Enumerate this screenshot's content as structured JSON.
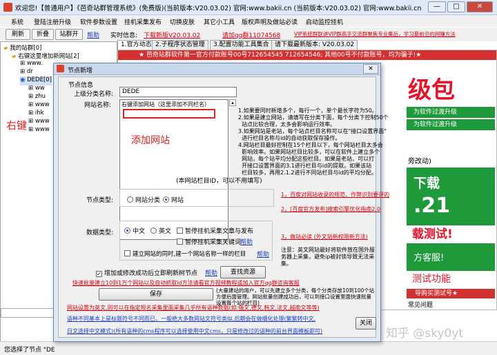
{
  "window": {
    "title": "欢迎您!【普通用户】《芭奇站群管理系统》(免费版)(当前版本:V20.03.02) 官网:www.bakii.cn (当前版本:V20.03.02) 官网:www.bakii.cn",
    "minimize": "—",
    "maximize": "□",
    "close": "✕"
  },
  "menu": [
    "系统",
    "登陆注册升级",
    "软件参数设置",
    "挂机采集发布",
    "切换皮肤",
    "其它小工具",
    "版权声明及做站必读",
    "启动监控挂机"
  ],
  "toolbar": {
    "refresh": "刷新",
    "collapse": "折叠",
    "expand": "站群开",
    "help": "帮助",
    "info_label": "实时信息:",
    "download": "下载新版V20.03.02",
    "qq_group": "请加qq群11074568",
    "vip_notice": "VIP系统群联讲VIP群高手交流群聚焦专业集后，学习最前沿的网赚方法"
  },
  "tree": {
    "root": "我的站群[0]",
    "add_hint": "右键这里增加新网站[2]",
    "rows": [
      "www.",
      "dr",
      "DEDE[0]",
      "ww",
      "zhu",
      "www",
      "ihk",
      "www",
      "www"
    ]
  },
  "annotation_right_click": "右键",
  "tabs": [
    "1.官方动态",
    "2.子程序状态管理",
    "3.配置功能工具集合",
    "请下载最新版本: V20.03.02"
  ],
  "banner": {
    "ad_text": "★ 芭奇站群软件第一官方付款账号00号712654545 712654546; 其他00号不付款账号，均为骗子!★",
    "big_text": "级包",
    "btn1": "为软件过渡升级",
    "btn2": "为软件过渡升级",
    "event": "旁改动)",
    "download": "下载",
    "version": ".21",
    "free_test": "载测试!",
    "support": "方客服!",
    "test_func": "测试功能",
    "buy_link": "导购买测试号★",
    "help_link": "常见问题",
    "watermark": "知乎 @sky0yt"
  },
  "dialog": {
    "title": "节点新增",
    "close": "✕",
    "section": "节点信息",
    "parent_label": "上级分类名称:",
    "parent_value": "DEDE",
    "name_label": "网站名称:",
    "name_value": "右键添加网站（这里添加不同栏名）",
    "annotation": "添加网站",
    "notes": "1.如果要同时新增多个，每行一个，单个最长字符为50。\n2.如果是建立网站，请填写在分类下面，每个分类下控制50个\n  站点比较合理，太多会影响运行效率。\n3.如果网站是老站，每个站点栏目名称可以在\"接口设置界面\"\n  进行栏目名称与id的自动获取保存操作。\n4.网站栏目最好控制在15个栏目以下，每个网站栏目太多会\n  影响效率。如果网站栏目比较多，可以在软件上建立多个\n  网站，每个站平均分配这些栏目。如果是老站，可以打\n  开接口设置界面的3.1进行栏目与id的提取。如果该站\n  栏目较多，再用2.1.2进行不同站栏目与id的平均分配。",
    "id_note": "(本网站栏目ID，可以不用填写)",
    "node_type_label": "节点类型:",
    "radio_category": "网站分类",
    "radio_site": "网站",
    "link1": "1，百度对网站收录的规范、作弊识别要评的",
    "link2": "2，[百度官方发布]搜索引擎优化指南2.0",
    "data_type_label": "数据类型:",
    "radio_cn": "中文",
    "radio_en": "英文",
    "check_pause_collect": "暂停挂机采集文章与发布",
    "check_pause_keyword": "暂停挂机采集关键词",
    "help1": "帮助",
    "check_build_same": "建立网站的同时,建一个网站名称一样的栏目",
    "help2": "帮助",
    "link3": "3，做站必读 (外文站新权限新方法)",
    "en_note": "注意：英文网站最好将软件放在国外服务器上采集，避免ip被封锁导致无法采集。",
    "check_refresh": "增加或修改成功后立即刷新树节点",
    "help3": "帮助",
    "find_resource": "查找资源",
    "fast_build_link": "快速批量建立10到1万个网站以及自动抓取id方法请看官方视频教程或加入官方qq群咨询客服",
    "save": "保存",
    "save_note": "(大量建站的用户，可以先建立多个分类，每个分类存放10到100个站方便后面管理。网站批量创建成功后，可以到接口设置里面快速批量设置每个站的栏目)",
    "warn_red": "网站设置为英文,则可以在指定规名采集里面采集几乎所有语种数据(如:俄文,德文,韩文,法文,越南文等等)",
    "warn_blue1": "语种不同基本上是标题符号不同而已，一般绝大多数网站文符号类似,后期会在做细化处理(繁繁转中文,",
    "warn_blue2": "日文选择中文模式)(所有语种的cms程序可以选择使用中文cms，只是修改过的语种的前台界面模板即可)",
    "close_btn": "关闭"
  },
  "status": "您选择了节点 \"DE"
}
